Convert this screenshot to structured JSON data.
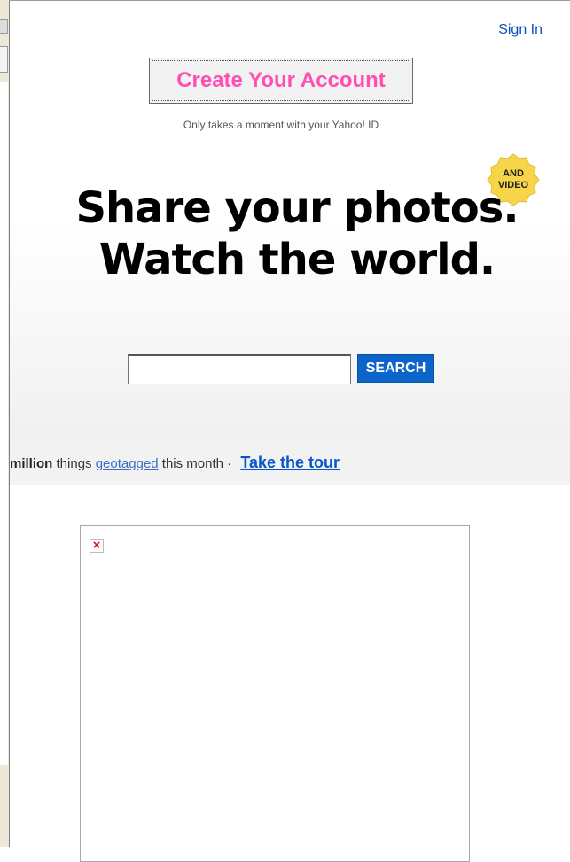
{
  "header": {
    "sign_in": "Sign In"
  },
  "signup": {
    "create_account_label": "Create Your Account",
    "tagline": "Only takes a moment with your Yahoo! ID"
  },
  "hero": {
    "line1": "Share your photos.",
    "line2": "Watch the world.",
    "badge_line1": "AND",
    "badge_line2": "VIDEO",
    "badge_color": "#f7d548"
  },
  "search": {
    "input_value": "",
    "button_label": "SEARCH",
    "button_color": "#0b64c9"
  },
  "stats": {
    "count_text": "million",
    "things_text": "things",
    "geotagged_link": "geotagged",
    "suffix_text": "this month ·",
    "tour_link": "Take the tour"
  },
  "image": {
    "broken_icon": "broken-image-icon"
  }
}
